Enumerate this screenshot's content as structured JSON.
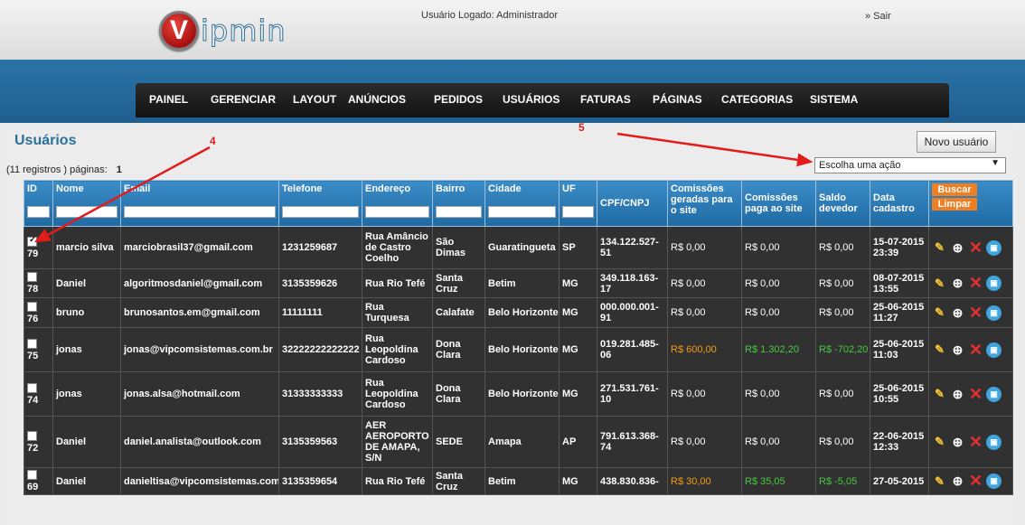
{
  "header": {
    "logo_letter": "V",
    "logo_rest": "ipmin",
    "logged_user": "Usuário Logado: Administrador",
    "logout": "» Sair"
  },
  "menu": [
    "PAINEL",
    "GERENCIAR",
    "LAYOUT",
    "ANÚNCIOS",
    "PEDIDOS",
    "USUÁRIOS",
    "FATURAS",
    "PÁGINAS",
    "CATEGORIAS",
    "SISTEMA"
  ],
  "page": {
    "title": "Usuários",
    "new_button": "Novo usuário",
    "records": "(11 registros ) páginas:",
    "page_number": "1",
    "action_select": "Escolha uma ação"
  },
  "annotations": {
    "a4": "4",
    "a5": "5",
    "color": "#e31b1b"
  },
  "table": {
    "headers": [
      "ID",
      "Nome",
      "Email",
      "Telefone",
      "Endereço",
      "Bairro",
      "Cidade",
      "UF",
      "CPF/CNPJ",
      "Comissões geradas para o site",
      "Comissões paga ao site",
      "Saldo devedor",
      "Data cadastro"
    ],
    "search_button": "Buscar",
    "clear_button": "Limpar",
    "rows": [
      {
        "id": "79",
        "checked": true,
        "nome": "marcio silva",
        "email": "marciobrasil37@gmail.com",
        "telefone": "1231259687",
        "endereco": "Rua Amâncio de Castro Coelho",
        "bairro": "São Dimas",
        "cidade": "Guaratingueta",
        "uf": "SP",
        "cpf": "134.122.527-51",
        "geradas": "R$ 0,00",
        "paga": "R$ 0,00",
        "saldo": "R$ 0,00",
        "data": "15-07-2015 23:39"
      },
      {
        "id": "78",
        "checked": false,
        "nome": "Daniel",
        "email": "algoritmosdaniel@gmail.com",
        "telefone": "3135359626",
        "endereco": "Rua Rio Tefé",
        "bairro": "Santa Cruz",
        "cidade": "Betim",
        "uf": "MG",
        "cpf": "349.118.163-17",
        "geradas": "R$ 0,00",
        "paga": "R$ 0,00",
        "saldo": "R$ 0,00",
        "data": "08-07-2015 13:55"
      },
      {
        "id": "76",
        "checked": false,
        "nome": "bruno",
        "email": "brunosantos.em@gmail.com",
        "telefone": "11111111",
        "endereco": "Rua Turquesa",
        "bairro": "Calafate",
        "cidade": "Belo Horizonte",
        "uf": "MG",
        "cpf": "000.000.001-91",
        "geradas": "R$ 0,00",
        "paga": "R$ 0,00",
        "saldo": "R$ 0,00",
        "data": "25-06-2015 11:27"
      },
      {
        "id": "75",
        "checked": false,
        "nome": "jonas",
        "email": "jonas@vipcomsistemas.com.br",
        "telefone": "32222222222222",
        "endereco": "Rua Leopoldina Cardoso",
        "bairro": "Dona Clara",
        "cidade": "Belo Horizonte",
        "uf": "MG",
        "cpf": "019.281.485-06",
        "geradas": "R$ 600,00",
        "paga": "R$ 1.302,20",
        "saldo": "R$ -702,20",
        "data": "25-06-2015 11:03"
      },
      {
        "id": "74",
        "checked": false,
        "nome": "jonas",
        "email": "jonas.alsa@hotmail.com",
        "telefone": "31333333333",
        "endereco": "Rua Leopoldina Cardoso",
        "bairro": "Dona Clara",
        "cidade": "Belo Horizonte",
        "uf": "MG",
        "cpf": "271.531.761-10",
        "geradas": "R$ 0,00",
        "paga": "R$ 0,00",
        "saldo": "R$ 0,00",
        "data": "25-06-2015 10:55"
      },
      {
        "id": "72",
        "checked": false,
        "nome": "Daniel",
        "email": "daniel.analista@outlook.com",
        "telefone": "3135359563",
        "endereco": "AER AEROPORTO DE AMAPA, S/N",
        "bairro": "SEDE",
        "cidade": "Amapa",
        "uf": "AP",
        "cpf": "791.613.368-74",
        "geradas": "R$ 0,00",
        "paga": "R$ 0,00",
        "saldo": "R$ 0,00",
        "data": "22-06-2015 12:33"
      },
      {
        "id": "69",
        "checked": false,
        "nome": "Daniel",
        "email": "danieltisa@vipcomsistemas.com.br",
        "telefone": "3135359654",
        "endereco": "Rua Rio Tefé",
        "bairro": "Santa Cruz",
        "cidade": "Betim",
        "uf": "MG",
        "cpf": "438.830.836-",
        "geradas": "R$ 30,00",
        "paga": "R$ 35,05",
        "saldo": "R$ -5,05",
        "data": "27-05-2015"
      }
    ]
  },
  "colors": {
    "orange_value": "#f39c12",
    "green_value": "#49c843",
    "header_blue": "#2b73a8"
  },
  "icons": [
    "edit-icon",
    "zoom-icon",
    "delete-icon",
    "save-icon"
  ]
}
